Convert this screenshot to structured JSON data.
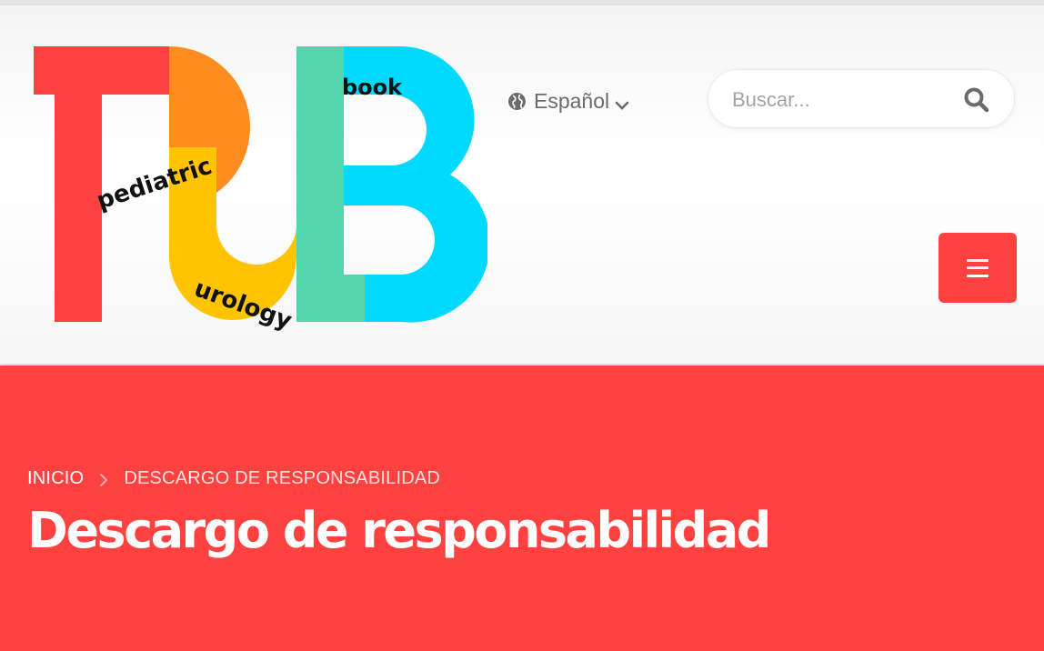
{
  "logo": {
    "letters": "PUB",
    "word_top": "book",
    "word_left": "pediatric",
    "word_bottom": "urology",
    "colors": {
      "red": "#ff423f",
      "orange": "#ff8c1e",
      "yellow": "#ffc300",
      "green": "#55d5ae",
      "cyan": "#00d9ff"
    }
  },
  "language": {
    "icon": "globe-icon",
    "label": "Español",
    "chevron": "chevron-down-icon"
  },
  "search": {
    "placeholder": "Buscar...",
    "value": "",
    "button_icon": "search-icon"
  },
  "menu_button": {
    "icon": "hamburger-icon",
    "color": "#ff423f"
  },
  "breadcrumb": {
    "items": [
      "INICIO",
      "DESCARGO DE RESPONSABILIDAD"
    ],
    "separator_icon": "chevron-right-icon"
  },
  "page": {
    "title": "Descargo de responsabilidad",
    "hero_color": "#ff423f"
  }
}
